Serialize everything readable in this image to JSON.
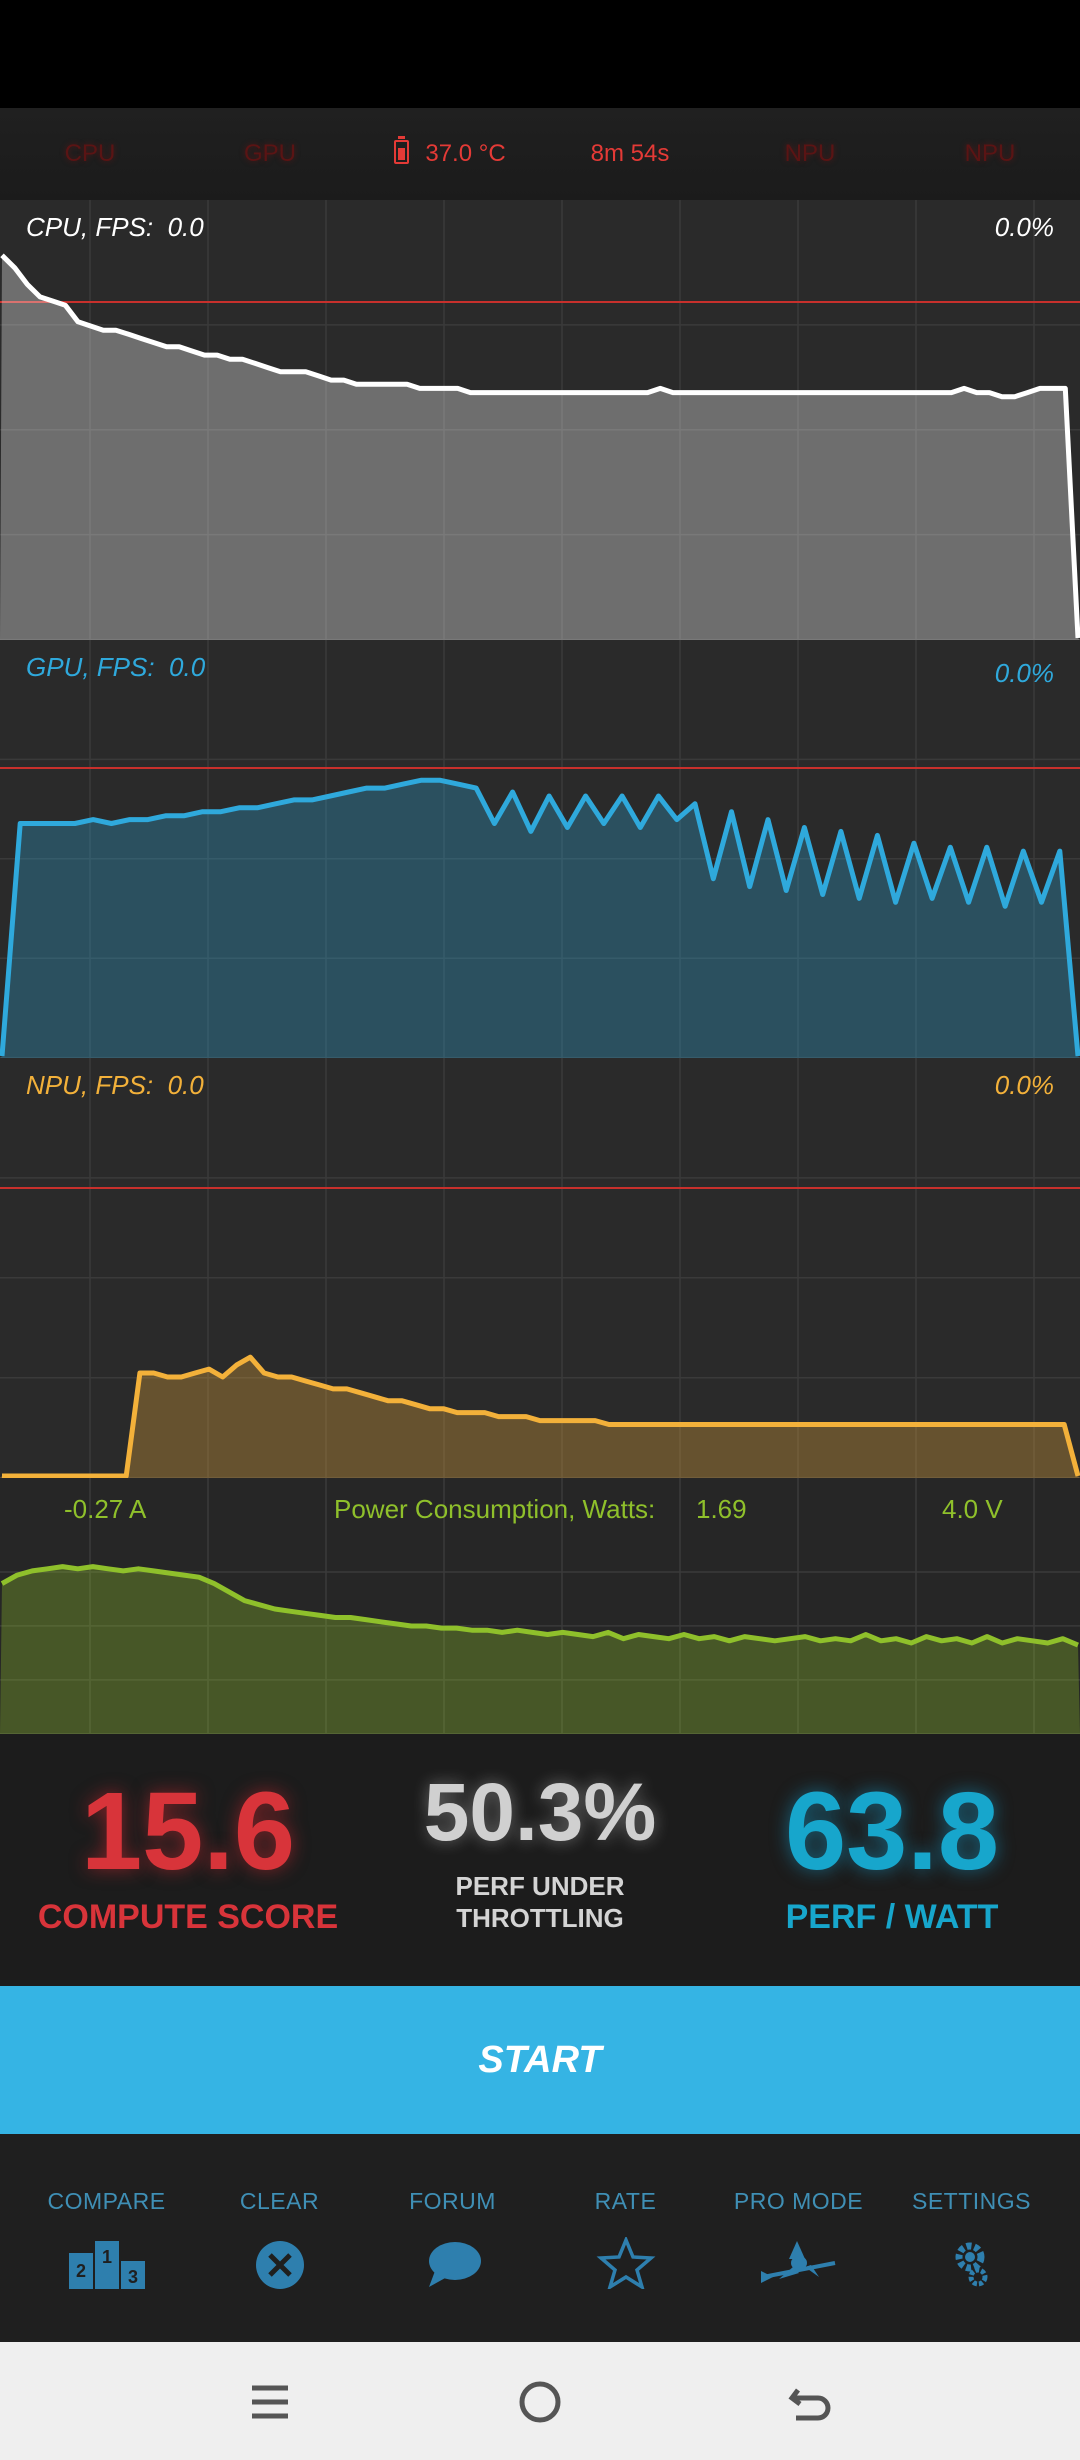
{
  "top_strip": {
    "cpu_label": "CPU",
    "gpu_label": "GPU",
    "temperature": "37.0 °C",
    "elapsed": "8m 54s",
    "npu_label_1": "NPU",
    "npu_label_2": "NPU"
  },
  "cpu_panel": {
    "label": "CPU, FPS:  0.0",
    "percent": "0.0%",
    "color": "#ffffff",
    "series": [
      92,
      89,
      85,
      82,
      81,
      80,
      76,
      75,
      74,
      74,
      73,
      72,
      71,
      70,
      70,
      69,
      68,
      68,
      67,
      67,
      66,
      65,
      64,
      64,
      64,
      63,
      62,
      62,
      61,
      61,
      61,
      61,
      61,
      60,
      60,
      60,
      60,
      59,
      59,
      59,
      59,
      59,
      59,
      59,
      59,
      59,
      59,
      59,
      59,
      59,
      59,
      59,
      60,
      59,
      59,
      59,
      59,
      59,
      59,
      59,
      59,
      59,
      59,
      59,
      59,
      59,
      59,
      59,
      59,
      59,
      59,
      59,
      59,
      59,
      59,
      59,
      60,
      59,
      59,
      58,
      58,
      59,
      60,
      60,
      60,
      0
    ]
  },
  "gpu_panel": {
    "label": "GPU, FPS:  0.0",
    "percent": "0.0%",
    "color": "#2fa9dc",
    "series": [
      0,
      59,
      59,
      59,
      59,
      60,
      59,
      60,
      60,
      61,
      61,
      62,
      62,
      63,
      63,
      64,
      65,
      65,
      66,
      67,
      68,
      68,
      69,
      70,
      70,
      69,
      68,
      59,
      67,
      57,
      66,
      58,
      66,
      59,
      66,
      58,
      66,
      60,
      64,
      45,
      62,
      43,
      60,
      42,
      58,
      41,
      57,
      40,
      56,
      39,
      54,
      40,
      53,
      39,
      53,
      38,
      52,
      39,
      52,
      0
    ]
  },
  "npu_panel": {
    "label": "NPU, FPS:  0.0",
    "percent": "0.0%",
    "color": "#f3b13a",
    "series": [
      0,
      0,
      0,
      0,
      0,
      0,
      0,
      0,
      0,
      0,
      26,
      26,
      25,
      25,
      26,
      27,
      25,
      28,
      30,
      26,
      25,
      25,
      24,
      23,
      22,
      22,
      21,
      20,
      19,
      19,
      18,
      17,
      17,
      16,
      16,
      16,
      15,
      15,
      15,
      14,
      14,
      14,
      14,
      14,
      13,
      13,
      13,
      13,
      13,
      13,
      13,
      13,
      13,
      13,
      13,
      13,
      13,
      13,
      13,
      13,
      13,
      13,
      13,
      13,
      13,
      13,
      13,
      13,
      13,
      13,
      13,
      13,
      13,
      13,
      13,
      13,
      13,
      13,
      0
    ]
  },
  "power_panel": {
    "current": "-0.27 A",
    "title": "Power Consumption, Watts:",
    "watts": "1.69",
    "voltage": "4.0 V",
    "color": "#8fc02b",
    "series": [
      70,
      74,
      76,
      77,
      78,
      77,
      78,
      77,
      76,
      77,
      76,
      75,
      74,
      73,
      70,
      66,
      62,
      60,
      58,
      57,
      56,
      55,
      54,
      54,
      53,
      52,
      51,
      50,
      50,
      49,
      49,
      48,
      48,
      47,
      48,
      47,
      46,
      47,
      46,
      45,
      47,
      44,
      46,
      45,
      44,
      46,
      44,
      45,
      43,
      45,
      44,
      43,
      44,
      45,
      43,
      44,
      43,
      46,
      43,
      44,
      42,
      45,
      43,
      44,
      42,
      45,
      42,
      44,
      43,
      42,
      44,
      41
    ]
  },
  "scores": {
    "compute_score": "15.6",
    "compute_label": "COMPUTE SCORE",
    "throttling": "50.3%",
    "throttling_label_1": "PERF UNDER",
    "throttling_label_2": "THROTTLING",
    "perf_watt": "63.8",
    "perf_watt_label": "PERF / WATT"
  },
  "start_label": "START",
  "nav": {
    "compare": "COMPARE",
    "clear": "CLEAR",
    "forum": "FORUM",
    "rate": "RATE",
    "pro_mode": "PRO MODE",
    "settings": "SETTINGS",
    "icon_color": "#2e7fae"
  },
  "podium_numbers": [
    "2",
    "1",
    "3"
  ]
}
